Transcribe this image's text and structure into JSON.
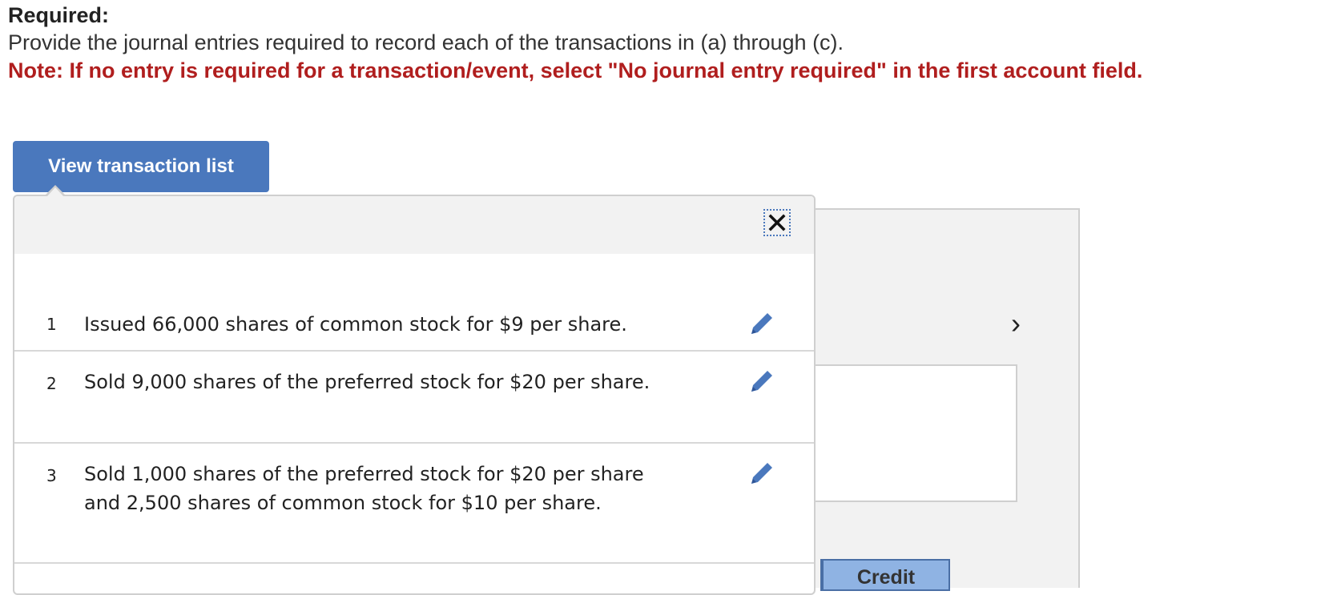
{
  "header": {
    "required_label": "Required:",
    "instructions": "Provide the journal entries required to record each of the transactions in (a) through (c).",
    "note": "Note: If no entry is required for a transaction/event, select \"No journal entry required\" in the first account field."
  },
  "view_button": {
    "label": "View transaction list"
  },
  "popup": {
    "transactions": [
      {
        "number": "1",
        "text": "Issued 66,000 shares of common stock for $9 per share."
      },
      {
        "number": "2",
        "text": "Sold 9,000 shares of the preferred stock for $20 per share."
      },
      {
        "number": "3",
        "text": "Sold 1,000 shares of the preferred stock for $20 per share and 2,500 shares of common stock for $10 per share."
      }
    ]
  },
  "background": {
    "credit_label": "Credit",
    "next_chevron": "›"
  },
  "icons": {
    "close": "close-icon",
    "edit": "pencil-icon",
    "next": "chevron-right-icon"
  },
  "colors": {
    "note_red": "#b01e1e",
    "button_blue": "#4a78bd",
    "credit_blue": "#8fb3e3"
  }
}
